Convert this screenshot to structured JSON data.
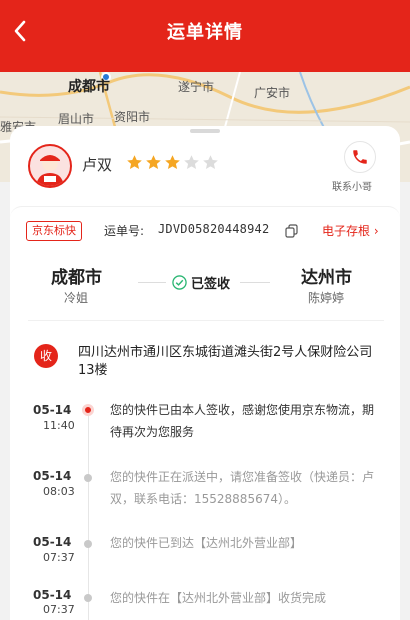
{
  "header": {
    "title": "运单详情"
  },
  "map": {
    "cities": [
      "成都市",
      "遂宁市",
      "广安市",
      "雅安市",
      "眉山市",
      "资阳市"
    ]
  },
  "courier": {
    "name": "卢双",
    "rating": 3,
    "rating_max": 5,
    "contact_label": "联系小哥"
  },
  "waybill": {
    "brand": "京东标快",
    "label": "运单号:",
    "number": "JDVD05820448942",
    "archive_label": "电子存根"
  },
  "route": {
    "from_city": "成都市",
    "from_name": "冷姐",
    "status": "已签收",
    "to_city": "达州市",
    "to_name": "陈婷婷"
  },
  "address": {
    "icon_label": "收",
    "text": "四川达州市通川区东城街道滩头街2号人保财险公司13楼"
  },
  "timeline": [
    {
      "date": "05-14",
      "time": "11:40",
      "text": "您的快件已由本人签收，感谢您使用京东物流，期待再次为您服务",
      "active": true
    },
    {
      "date": "05-14",
      "time": "08:03",
      "text": "您的快件正在派送中，请您准备签收（快递员：卢双，联系电话：15528885674）。",
      "active": false
    },
    {
      "date": "05-14",
      "time": "07:37",
      "text": "您的快件已到达【达州北外营业部】",
      "active": false
    },
    {
      "date": "05-14",
      "time": "07:37",
      "text": "您的快件在【达州北外营业部】收货完成",
      "active": false
    }
  ],
  "colors": {
    "brand_red": "#e4251a",
    "star_gold": "#f5a623",
    "success_green": "#2bb673"
  }
}
